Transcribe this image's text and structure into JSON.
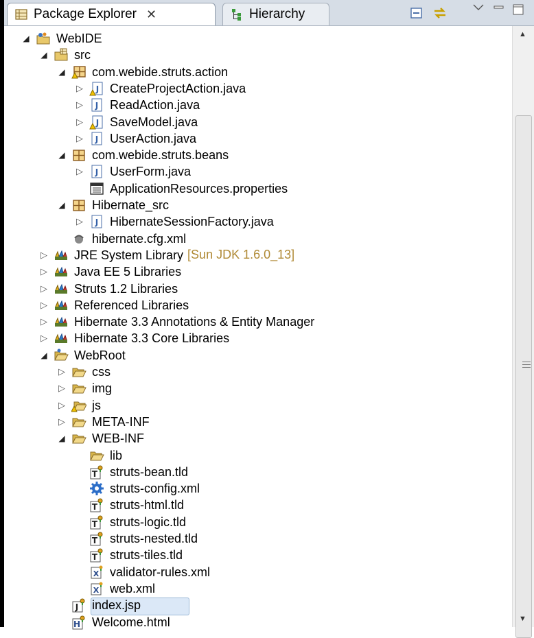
{
  "tabs": [
    {
      "label": "Package Explorer",
      "icon": "package-explorer-icon",
      "active": true,
      "close": "✕"
    },
    {
      "label": "Hierarchy",
      "icon": "hierarchy-icon",
      "active": false
    }
  ],
  "toolbar_icons": [
    "collapse-all-icon",
    "link-with-editor-icon",
    "view-menu-icon",
    "minimize-icon",
    "maximize-icon"
  ],
  "tree": [
    {
      "label": "WebIDE",
      "depth": 0,
      "twisty": "expanded",
      "icon": "project-icon"
    },
    {
      "label": "src",
      "depth": 1,
      "twisty": "expanded",
      "icon": "source-folder-icon"
    },
    {
      "label": "com.webide.struts.action",
      "depth": 2,
      "twisty": "expanded",
      "icon": "package-warning-icon"
    },
    {
      "label": "CreateProjectAction.java",
      "depth": 3,
      "twisty": "collapsed",
      "icon": "java-file-warning-icon"
    },
    {
      "label": "ReadAction.java",
      "depth": 3,
      "twisty": "collapsed",
      "icon": "java-file-icon"
    },
    {
      "label": "SaveModel.java",
      "depth": 3,
      "twisty": "collapsed",
      "icon": "java-file-warning-icon"
    },
    {
      "label": "UserAction.java",
      "depth": 3,
      "twisty": "collapsed",
      "icon": "java-file-icon"
    },
    {
      "label": "com.webide.struts.beans",
      "depth": 2,
      "twisty": "expanded",
      "icon": "package-icon"
    },
    {
      "label": "UserForm.java",
      "depth": 3,
      "twisty": "collapsed",
      "icon": "java-file-icon"
    },
    {
      "label": "ApplicationResources.properties",
      "depth": 3,
      "twisty": "none",
      "icon": "properties-file-icon"
    },
    {
      "label": "Hibernate_src",
      "depth": 2,
      "twisty": "expanded",
      "icon": "package-icon"
    },
    {
      "label": "HibernateSessionFactory.java",
      "depth": 3,
      "twisty": "collapsed",
      "icon": "java-file-icon"
    },
    {
      "label": "hibernate.cfg.xml",
      "depth": 2,
      "twisty": "none",
      "icon": "hibernate-config-icon"
    },
    {
      "label": "JRE System Library",
      "decoration": "[Sun JDK 1.6.0_13]",
      "depth": 1,
      "twisty": "collapsed",
      "icon": "library-icon"
    },
    {
      "label": "Java EE 5 Libraries",
      "depth": 1,
      "twisty": "collapsed",
      "icon": "library-icon"
    },
    {
      "label": "Struts 1.2 Libraries",
      "depth": 1,
      "twisty": "collapsed",
      "icon": "library-icon"
    },
    {
      "label": "Referenced Libraries",
      "depth": 1,
      "twisty": "collapsed",
      "icon": "library-icon"
    },
    {
      "label": "Hibernate 3.3 Annotations & Entity Manager",
      "depth": 1,
      "twisty": "collapsed",
      "icon": "library-icon"
    },
    {
      "label": "Hibernate 3.3 Core Libraries",
      "depth": 1,
      "twisty": "collapsed",
      "icon": "library-icon"
    },
    {
      "label": "WebRoot",
      "depth": 1,
      "twisty": "expanded",
      "icon": "folder-open-icon"
    },
    {
      "label": "css",
      "depth": 2,
      "twisty": "collapsed",
      "icon": "folder-icon"
    },
    {
      "label": "img",
      "depth": 2,
      "twisty": "collapsed",
      "icon": "folder-icon"
    },
    {
      "label": "js",
      "depth": 2,
      "twisty": "collapsed",
      "icon": "folder-warning-icon"
    },
    {
      "label": "META-INF",
      "depth": 2,
      "twisty": "collapsed",
      "icon": "folder-icon"
    },
    {
      "label": "WEB-INF",
      "depth": 2,
      "twisty": "expanded",
      "icon": "folder-icon"
    },
    {
      "label": "lib",
      "depth": 3,
      "twisty": "none",
      "icon": "folder-icon"
    },
    {
      "label": "struts-bean.tld",
      "depth": 3,
      "twisty": "none",
      "icon": "tld-file-icon"
    },
    {
      "label": "struts-config.xml",
      "depth": 3,
      "twisty": "none",
      "icon": "struts-config-gear-icon"
    },
    {
      "label": "struts-html.tld",
      "depth": 3,
      "twisty": "none",
      "icon": "tld-file-icon"
    },
    {
      "label": "struts-logic.tld",
      "depth": 3,
      "twisty": "none",
      "icon": "tld-file-icon"
    },
    {
      "label": "struts-nested.tld",
      "depth": 3,
      "twisty": "none",
      "icon": "tld-file-icon"
    },
    {
      "label": "struts-tiles.tld",
      "depth": 3,
      "twisty": "none",
      "icon": "tld-file-icon"
    },
    {
      "label": "validator-rules.xml",
      "depth": 3,
      "twisty": "none",
      "icon": "xml-file-icon"
    },
    {
      "label": "web.xml",
      "depth": 3,
      "twisty": "none",
      "icon": "xml-file-icon"
    },
    {
      "label": "index.jsp",
      "depth": 2,
      "twisty": "none",
      "icon": "jsp-file-icon",
      "selected": true
    },
    {
      "label": "Welcome.html",
      "depth": 2,
      "twisty": "none",
      "icon": "html-file-icon"
    }
  ],
  "colors": {
    "decoration": "#b08a36",
    "selection": "#dbe8f7",
    "tabbar": "#d6dde6"
  }
}
